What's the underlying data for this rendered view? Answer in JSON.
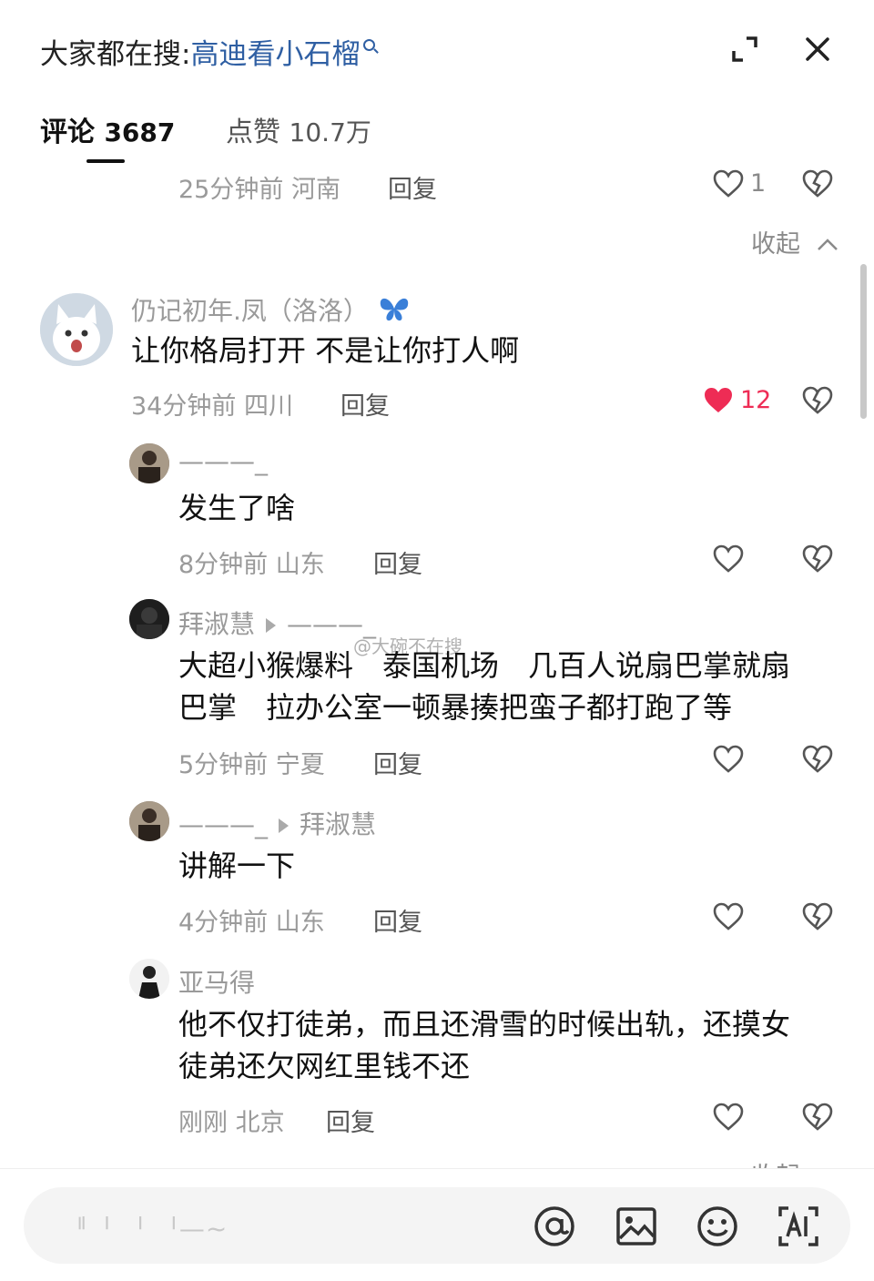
{
  "header": {
    "search_prefix": "大家都在搜:",
    "search_term": "高迪看小石榴"
  },
  "tabs": {
    "comments_label": "评论",
    "comments_count": "3687",
    "likes_label": "点赞",
    "likes_count": "10.7万"
  },
  "prev_comment": {
    "time_location": "25分钟前 河南",
    "reply_label": "回复",
    "like_count": "1",
    "collapse_label": "收起"
  },
  "comments": [
    {
      "username": "仍记初年.凤（洛洛）",
      "badge": "🦋",
      "text": "让你格局打开 不是让你打人啊",
      "time_location": "34分钟前 四川",
      "reply_label": "回复",
      "like_count": "12",
      "liked": true
    }
  ],
  "replies": [
    {
      "username": "———_",
      "text": [
        "发生了啥"
      ],
      "time_location": "8分钟前 山东",
      "reply_label": "回复"
    },
    {
      "username": "拜淑慧",
      "reply_to": "———_",
      "text": [
        "大超小猴爆料　泰国机场　几百人说扇巴掌就扇",
        "巴掌　拉办公室一顿暴揍把蛮子都打跑了等"
      ],
      "time_location": "5分钟前 宁夏",
      "reply_label": "回复"
    },
    {
      "username": "———_",
      "reply_to": "拜淑慧",
      "text": [
        "讲解一下"
      ],
      "time_location": "4分钟前 山东",
      "reply_label": "回复"
    },
    {
      "username": "亚马得",
      "text": [
        "他不仅打徒弟，而且还滑雪的时候出轨，还摸女",
        "徒弟还欠网红里钱不还"
      ],
      "time_location": "刚刚 北京",
      "reply_label": "回复"
    }
  ],
  "watermark": "@大碗不在搜",
  "bottom_cut_text": "收起",
  "input": {
    "placeholder": "ᅵᅵᅵ ᅵ ᅵ—~"
  },
  "icons": {
    "expand": "expand-icon",
    "close": "close-icon",
    "heart": "heart-icon",
    "dislike": "broken-heart-icon",
    "mention": "at-icon",
    "image": "image-icon",
    "emoji": "emoji-icon",
    "ai": "ai-icon"
  },
  "colors": {
    "accent_link": "#2f5fa3",
    "liked_heart": "#ee2c55"
  }
}
